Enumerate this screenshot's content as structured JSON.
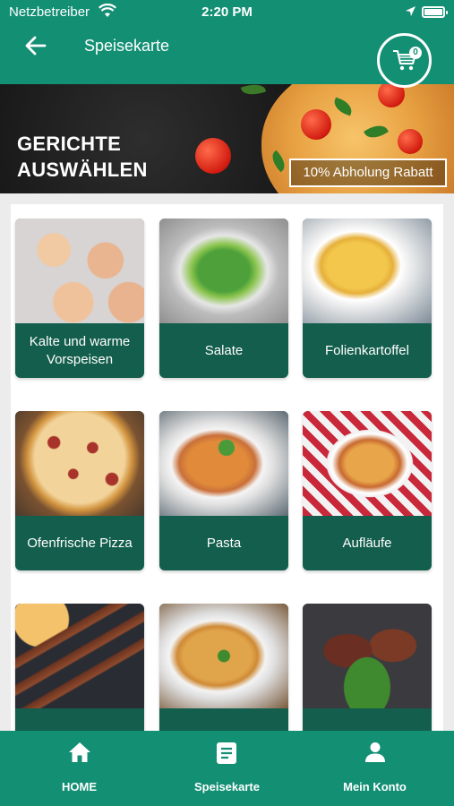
{
  "status_bar": {
    "carrier": "Netzbetreiber",
    "time": "2:20 PM"
  },
  "header": {
    "title": "Speisekarte",
    "cart_count": "0"
  },
  "banner": {
    "title_line1": "GERICHTE",
    "title_line2": "AUSWÄHLEN",
    "promo": "10% Abholung Rabatt"
  },
  "categories": [
    {
      "label": "Kalte und warme Vorspeisen"
    },
    {
      "label": "Salate"
    },
    {
      "label": "Folienkartoffel"
    },
    {
      "label": "Ofenfrische Pizza"
    },
    {
      "label": "Pasta"
    },
    {
      "label": "Aufläufe"
    },
    {
      "label": ""
    },
    {
      "label": ""
    },
    {
      "label": ""
    }
  ],
  "bottom_nav": [
    {
      "label": "HOME",
      "icon": "home-icon"
    },
    {
      "label": "Speisekarte",
      "icon": "menu-list-icon"
    },
    {
      "label": "Mein Konto",
      "icon": "user-icon"
    }
  ],
  "colors": {
    "primary": "#138f74",
    "tile_label": "#135e4c"
  }
}
